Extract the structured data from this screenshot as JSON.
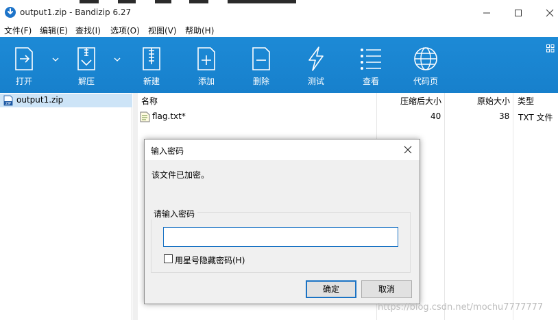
{
  "window": {
    "title": "output1.zip - Bandizip 6.27"
  },
  "menu": [
    "文件(F)",
    "编辑(E)",
    "查找(I)",
    "选项(O)",
    "视图(V)",
    "帮助(H)"
  ],
  "toolbar": {
    "buttons": [
      {
        "label": "打开",
        "icon": "open-icon"
      },
      {
        "label": "解压",
        "icon": "extract-icon"
      },
      {
        "label": "新建",
        "icon": "new-archive-icon"
      },
      {
        "label": "添加",
        "icon": "add-file-icon"
      },
      {
        "label": "删除",
        "icon": "delete-file-icon"
      },
      {
        "label": "测试",
        "icon": "test-icon"
      },
      {
        "label": "查看",
        "icon": "view-icon"
      },
      {
        "label": "代码页",
        "icon": "globe-icon"
      }
    ]
  },
  "tree": {
    "items": [
      {
        "label": "output1.zip"
      }
    ]
  },
  "list": {
    "columns": {
      "name": "名称",
      "compressed": "压缩后大小",
      "original": "原始大小",
      "type": "类型"
    },
    "rows": [
      {
        "name": "flag.txt*",
        "compressed": "40",
        "original": "38",
        "type": "TXT 文件"
      }
    ]
  },
  "dialog": {
    "title": "输入密码",
    "message": "该文件已加密。",
    "group_label": "请输入密码",
    "password_value": "",
    "checkbox_label": "用星号隐藏密码(H)",
    "checkbox_checked": false,
    "ok_label": "确定",
    "cancel_label": "取消"
  },
  "watermark": "https://blog.csdn.net/mochu7777777",
  "colors": {
    "accent": "#1780cc",
    "selection": "#cde4f7",
    "focus": "#1b73c4"
  }
}
